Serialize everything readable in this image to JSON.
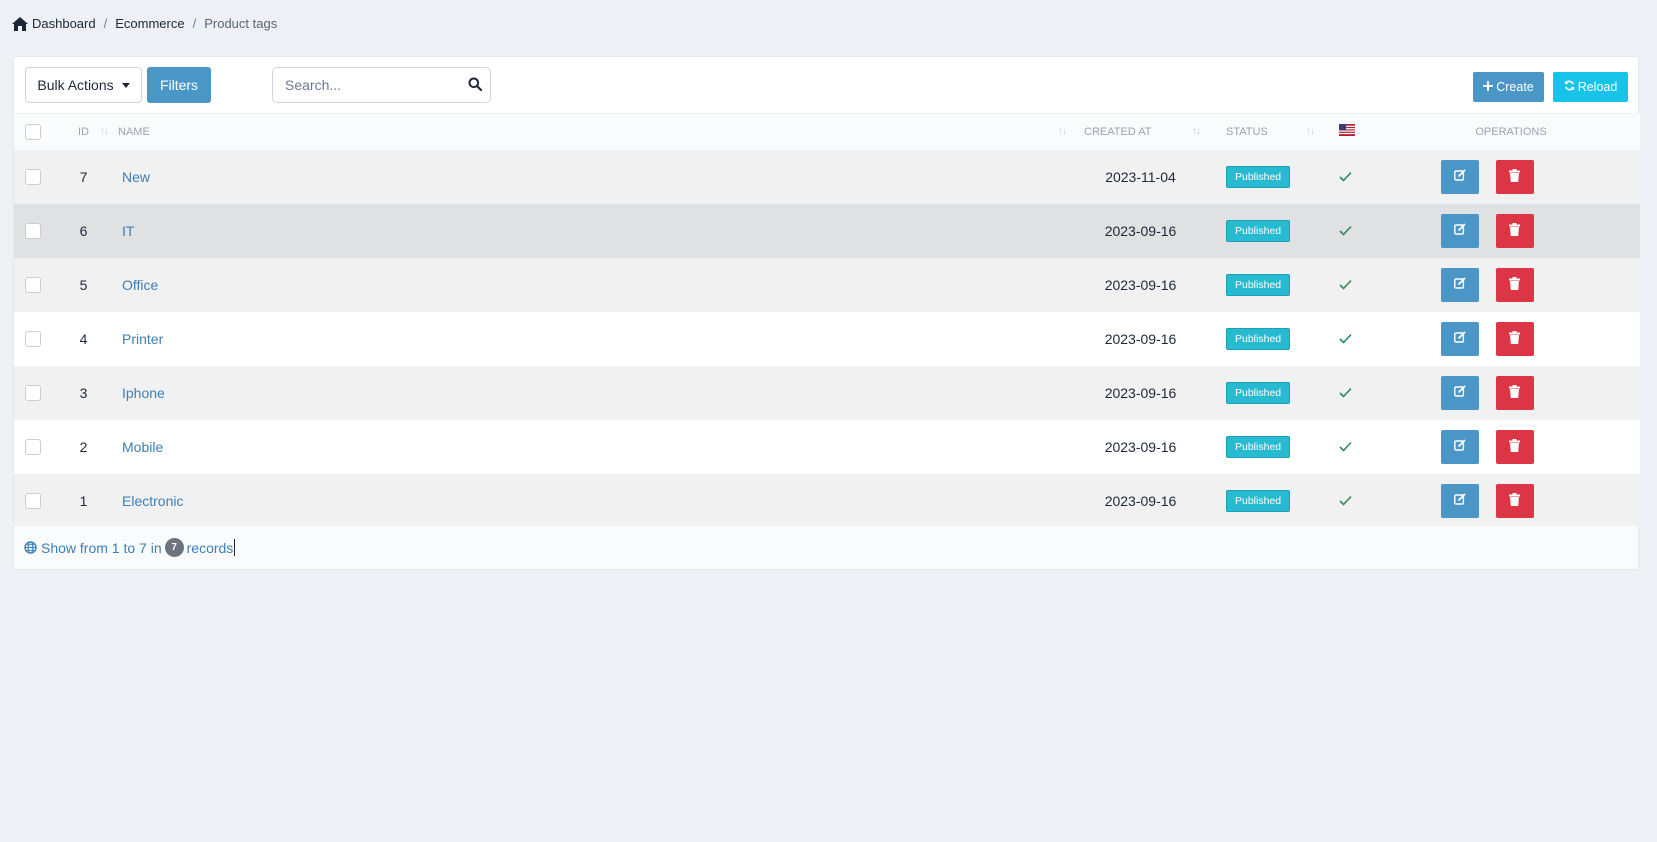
{
  "breadcrumb": {
    "items": [
      "Dashboard",
      "Ecommerce"
    ],
    "current": "Product tags",
    "separator": "/"
  },
  "toolbar": {
    "bulk_actions_label": "Bulk Actions",
    "filters_label": "Filters",
    "search_placeholder": "Search...",
    "search_value": "",
    "create_label": "Create",
    "reload_label": "Reload"
  },
  "table": {
    "columns": {
      "id": "ID",
      "name": "NAME",
      "created_at": "CREATED AT",
      "status": "STATUS",
      "language_icon": "us-flag-icon",
      "operations": "OPERATIONS"
    },
    "rows": [
      {
        "id": "7",
        "name": "New",
        "created_at": "2023-11-04",
        "status": "Published"
      },
      {
        "id": "6",
        "name": "IT",
        "created_at": "2023-09-16",
        "status": "Published"
      },
      {
        "id": "5",
        "name": "Office",
        "created_at": "2023-09-16",
        "status": "Published"
      },
      {
        "id": "4",
        "name": "Printer",
        "created_at": "2023-09-16",
        "status": "Published"
      },
      {
        "id": "3",
        "name": "Iphone",
        "created_at": "2023-09-16",
        "status": "Published"
      },
      {
        "id": "2",
        "name": "Mobile",
        "created_at": "2023-09-16",
        "status": "Published"
      },
      {
        "id": "1",
        "name": "Electronic",
        "created_at": "2023-09-16",
        "status": "Published"
      }
    ]
  },
  "footer": {
    "prefix": "Show from 1 to 7 in",
    "count": "7",
    "suffix": "records"
  },
  "colors": {
    "primary": "#4a96c6",
    "info": "#17c3e9",
    "danger": "#dc3545",
    "status_badge": "#28bad0",
    "check": "#2e8b57",
    "link": "#3d7fb6",
    "background": "#edf0f4"
  }
}
